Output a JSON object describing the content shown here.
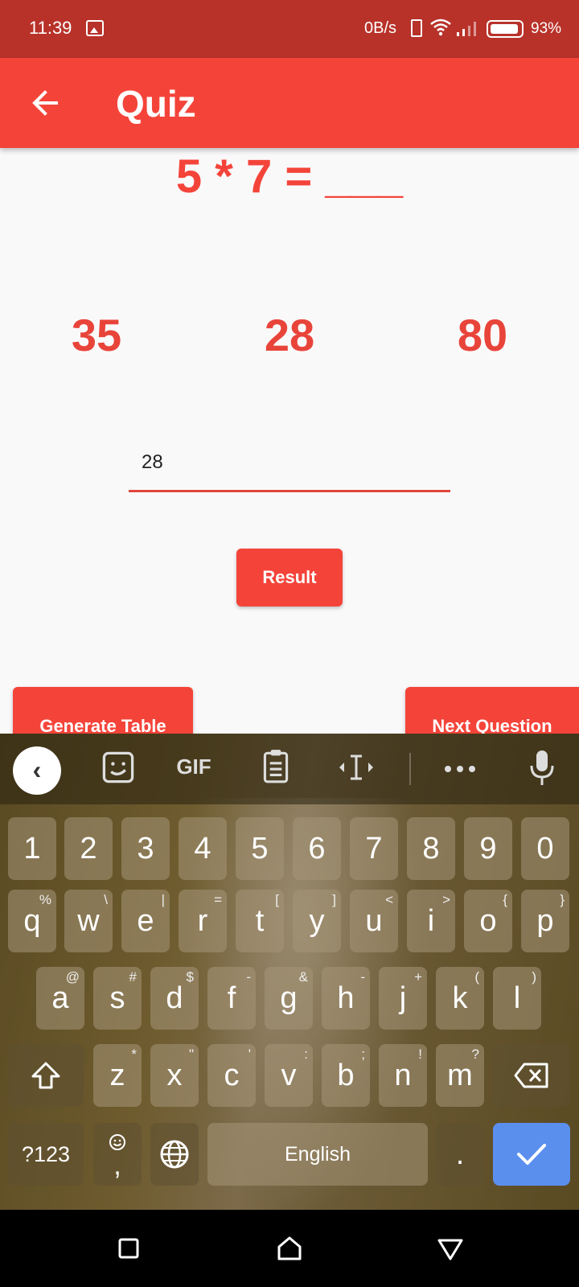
{
  "status_bar": {
    "time": "11:39",
    "speed": "0B/s",
    "battery": "93%",
    "icons": [
      "gallery-icon",
      "phone-icon",
      "wifi-icon",
      "signal-icon",
      "battery-icon"
    ]
  },
  "app_bar": {
    "title": "Quiz",
    "back_icon": "arrow-left-icon"
  },
  "quiz": {
    "question": "5 * 7 = ___",
    "options": [
      "35",
      "28",
      "80"
    ],
    "answer_value": "28",
    "result_label": "Result",
    "generate_table_label": "Generate Table",
    "next_question_label": "Next Question"
  },
  "keyboard": {
    "toolbar": {
      "gif_label": "GIF",
      "icons": [
        "chevron-left-icon",
        "sticker-icon",
        "gif-icon",
        "clipboard-icon",
        "text-cursor-icon",
        "more-icon",
        "mic-icon"
      ]
    },
    "row_numbers": [
      "1",
      "2",
      "3",
      "4",
      "5",
      "6",
      "7",
      "8",
      "9",
      "0"
    ],
    "row1": [
      "q",
      "w",
      "e",
      "r",
      "t",
      "y",
      "u",
      "i",
      "o",
      "p"
    ],
    "row1_hints": [
      "%",
      "\\",
      "|",
      "=",
      "[",
      "]",
      "<",
      ">",
      "{",
      "}"
    ],
    "row2": [
      "a",
      "s",
      "d",
      "f",
      "g",
      "h",
      "j",
      "k",
      "l"
    ],
    "row2_hints": [
      "@",
      "#",
      "$",
      "-",
      "&",
      "-",
      "+",
      "(",
      ")"
    ],
    "row3": [
      "z",
      "x",
      "c",
      "v",
      "b",
      "n",
      "m"
    ],
    "row3_hints": [
      "*",
      "\"",
      "'",
      ":",
      ";",
      "!",
      "?"
    ],
    "symbols_label": "?123",
    "comma_label": ",",
    "space_label": "English",
    "period_label": ".",
    "colors": {
      "enter": "#5b8fee"
    }
  },
  "colors": {
    "primary": "#f4443a",
    "status_bar": "#b8322a",
    "background": "#faf9fa"
  }
}
